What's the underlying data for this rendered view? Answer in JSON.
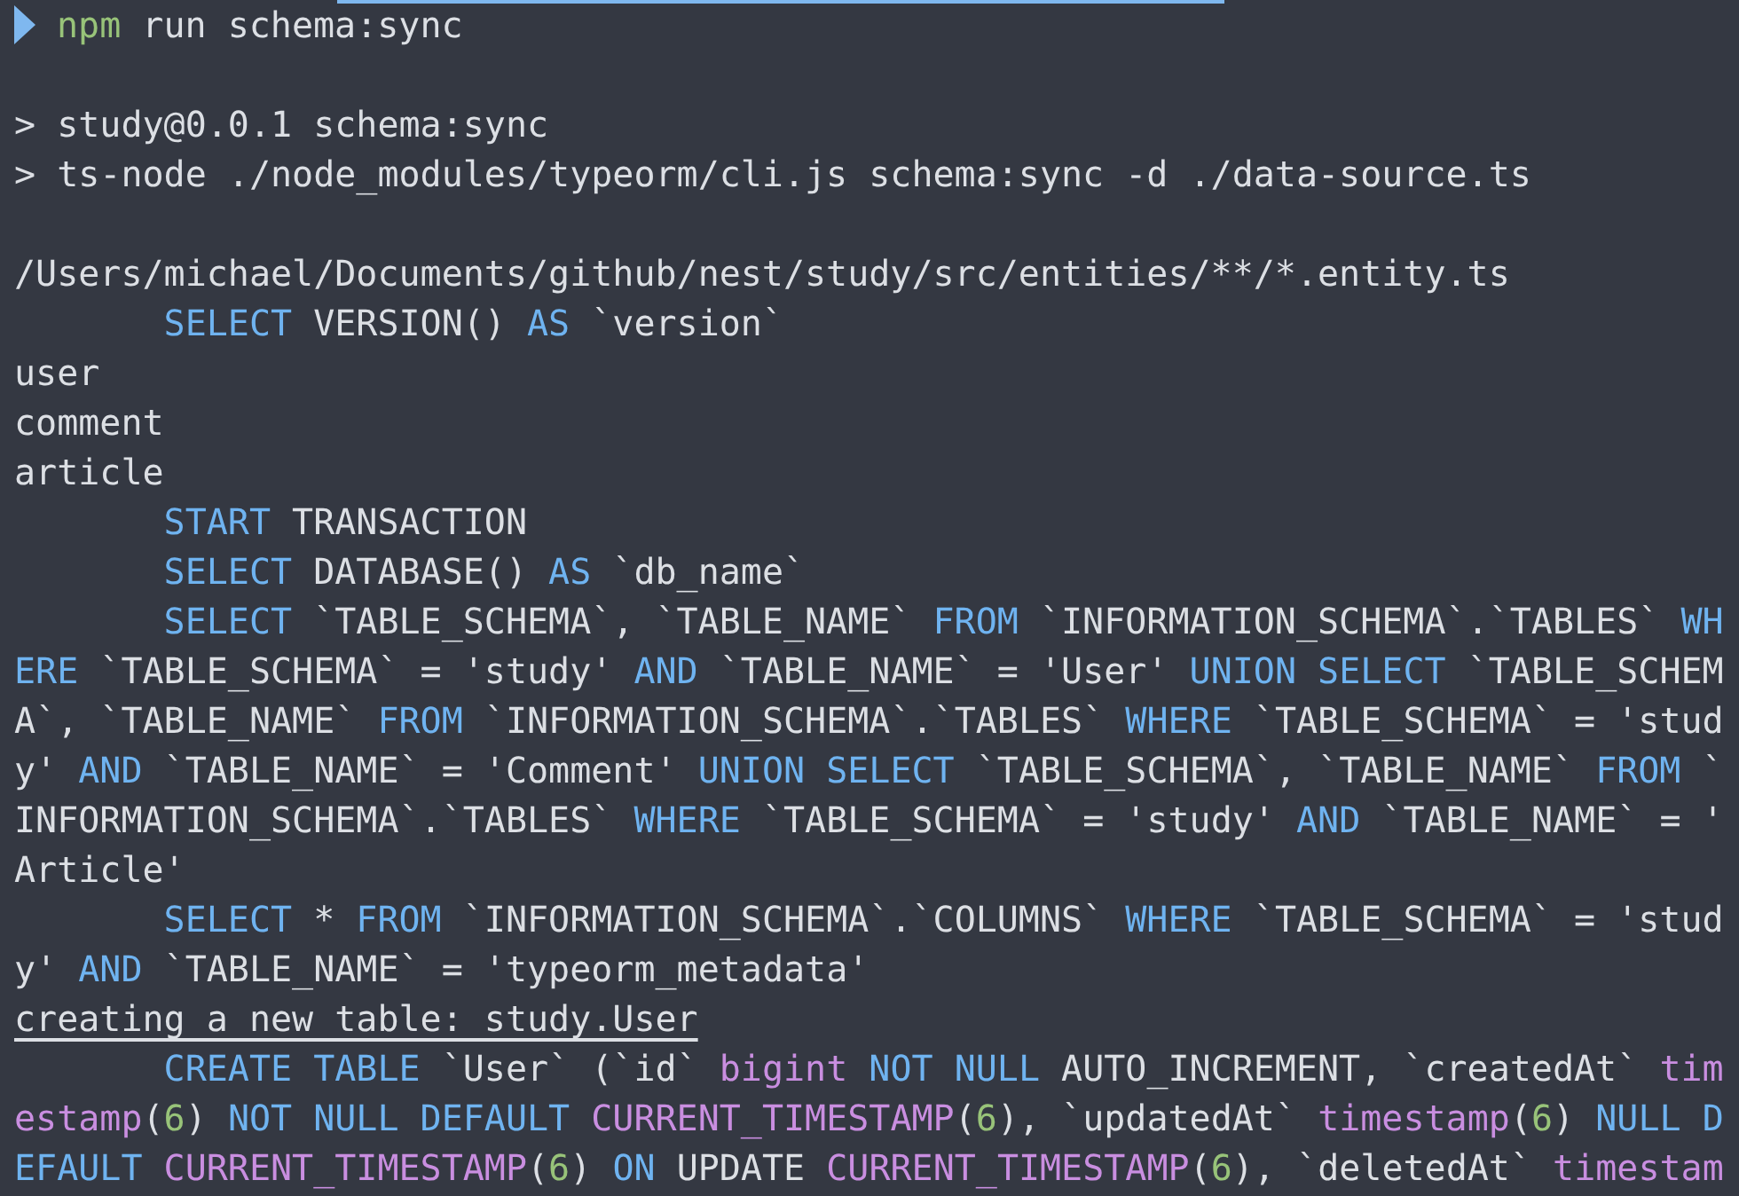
{
  "terminal": {
    "lines": [
      {
        "kind": "prompt",
        "indent": false,
        "segments": [
          {
            "kind": "cmd",
            "text": "npm"
          },
          {
            "kind": "plain",
            "text": " run schema:sync"
          }
        ]
      },
      {
        "kind": "blank"
      },
      {
        "kind": "output",
        "indent": false,
        "segments": [
          {
            "kind": "plain",
            "text": "> study@0.0.1 schema:sync"
          }
        ]
      },
      {
        "kind": "output",
        "indent": false,
        "segments": [
          {
            "kind": "plain",
            "text": "> ts-node ./node_modules/typeorm/cli.js schema:sync -d ./data-source.ts"
          }
        ]
      },
      {
        "kind": "blank"
      },
      {
        "kind": "output",
        "indent": false,
        "segments": [
          {
            "kind": "plain",
            "text": "/Users/michael/Documents/github/nest/study/src/entities/**/*.entity.ts"
          }
        ]
      },
      {
        "kind": "output",
        "indent": true,
        "segments": [
          {
            "kind": "keyword",
            "text": "SELECT"
          },
          {
            "kind": "plain",
            "text": " VERSION() "
          },
          {
            "kind": "keyword",
            "text": "AS"
          },
          {
            "kind": "plain",
            "text": " `version`"
          }
        ]
      },
      {
        "kind": "output",
        "indent": false,
        "segments": [
          {
            "kind": "plain",
            "text": "user"
          }
        ]
      },
      {
        "kind": "output",
        "indent": false,
        "segments": [
          {
            "kind": "plain",
            "text": "comment"
          }
        ]
      },
      {
        "kind": "output",
        "indent": false,
        "segments": [
          {
            "kind": "plain",
            "text": "article"
          }
        ]
      },
      {
        "kind": "output",
        "indent": true,
        "segments": [
          {
            "kind": "keyword",
            "text": "START"
          },
          {
            "kind": "plain",
            "text": " TRANSACTION"
          }
        ]
      },
      {
        "kind": "output",
        "indent": true,
        "segments": [
          {
            "kind": "keyword",
            "text": "SELECT"
          },
          {
            "kind": "plain",
            "text": " DATABASE() "
          },
          {
            "kind": "keyword",
            "text": "AS"
          },
          {
            "kind": "plain",
            "text": " `db_name`"
          }
        ]
      },
      {
        "kind": "output",
        "indent": true,
        "segments": [
          {
            "kind": "keyword",
            "text": "SELECT"
          },
          {
            "kind": "plain",
            "text": " `TABLE_SCHEMA`, `TABLE_NAME` "
          },
          {
            "kind": "keyword",
            "text": "FROM"
          },
          {
            "kind": "plain",
            "text": " `INFORMATION_SCHEMA`.`TABLES` "
          },
          {
            "kind": "keyword",
            "text": "WH"
          }
        ]
      },
      {
        "kind": "output",
        "indent": false,
        "segments": [
          {
            "kind": "keyword",
            "text": "ERE"
          },
          {
            "kind": "plain",
            "text": " `TABLE_SCHEMA` = 'study' "
          },
          {
            "kind": "keyword",
            "text": "AND"
          },
          {
            "kind": "plain",
            "text": " `TABLE_NAME` = 'User' "
          },
          {
            "kind": "keyword",
            "text": "UNION SELECT"
          },
          {
            "kind": "plain",
            "text": " `TABLE_SCHEM"
          }
        ]
      },
      {
        "kind": "output",
        "indent": false,
        "segments": [
          {
            "kind": "plain",
            "text": "A`, `TABLE_NAME` "
          },
          {
            "kind": "keyword",
            "text": "FROM"
          },
          {
            "kind": "plain",
            "text": " `INFORMATION_SCHEMA`.`TABLES` "
          },
          {
            "kind": "keyword",
            "text": "WHERE"
          },
          {
            "kind": "plain",
            "text": " `TABLE_SCHEMA` = 'stud"
          }
        ]
      },
      {
        "kind": "output",
        "indent": false,
        "segments": [
          {
            "kind": "plain",
            "text": "y' "
          },
          {
            "kind": "keyword",
            "text": "AND"
          },
          {
            "kind": "plain",
            "text": " `TABLE_NAME` = 'Comment' "
          },
          {
            "kind": "keyword",
            "text": "UNION SELECT"
          },
          {
            "kind": "plain",
            "text": " `TABLE_SCHEMA`, `TABLE_NAME` "
          },
          {
            "kind": "keyword",
            "text": "FROM"
          },
          {
            "kind": "plain",
            "text": " `"
          }
        ]
      },
      {
        "kind": "output",
        "indent": false,
        "segments": [
          {
            "kind": "plain",
            "text": "INFORMATION_SCHEMA`.`TABLES` "
          },
          {
            "kind": "keyword",
            "text": "WHERE"
          },
          {
            "kind": "plain",
            "text": " `TABLE_SCHEMA` = 'study' "
          },
          {
            "kind": "keyword",
            "text": "AND"
          },
          {
            "kind": "plain",
            "text": " `TABLE_NAME` = '"
          }
        ]
      },
      {
        "kind": "output",
        "indent": false,
        "segments": [
          {
            "kind": "plain",
            "text": "Article'"
          }
        ]
      },
      {
        "kind": "output",
        "indent": true,
        "segments": [
          {
            "kind": "keyword",
            "text": "SELECT"
          },
          {
            "kind": "plain",
            "text": " * "
          },
          {
            "kind": "keyword",
            "text": "FROM"
          },
          {
            "kind": "plain",
            "text": " `INFORMATION_SCHEMA`.`COLUMNS` "
          },
          {
            "kind": "keyword",
            "text": "WHERE"
          },
          {
            "kind": "plain",
            "text": " `TABLE_SCHEMA` = 'stud"
          }
        ]
      },
      {
        "kind": "output",
        "indent": false,
        "segments": [
          {
            "kind": "plain",
            "text": "y' "
          },
          {
            "kind": "keyword",
            "text": "AND"
          },
          {
            "kind": "plain",
            "text": " `TABLE_NAME` = 'typeorm_metadata'"
          }
        ]
      },
      {
        "kind": "underline",
        "indent": false,
        "segments": [
          {
            "kind": "plain",
            "text": "creating a new table: study.User"
          }
        ]
      },
      {
        "kind": "output",
        "indent": true,
        "segments": [
          {
            "kind": "keyword",
            "text": "CREATE TABLE"
          },
          {
            "kind": "plain",
            "text": " `User` (`id` "
          },
          {
            "kind": "type",
            "text": "bigint"
          },
          {
            "kind": "keyword",
            "text": " NOT NULL"
          },
          {
            "kind": "plain",
            "text": " AUTO_INCREMENT, `createdAt` "
          },
          {
            "kind": "type",
            "text": "tim"
          }
        ]
      },
      {
        "kind": "output",
        "indent": false,
        "segments": [
          {
            "kind": "type",
            "text": "estamp"
          },
          {
            "kind": "plain",
            "text": "("
          },
          {
            "kind": "number",
            "text": "6"
          },
          {
            "kind": "plain",
            "text": ") "
          },
          {
            "kind": "keyword",
            "text": "NOT NULL DEFAULT "
          },
          {
            "kind": "type",
            "text": "CURRENT_TIMESTAMP"
          },
          {
            "kind": "plain",
            "text": "("
          },
          {
            "kind": "number",
            "text": "6"
          },
          {
            "kind": "plain",
            "text": "), `updatedAt` "
          },
          {
            "kind": "type",
            "text": "timestamp"
          },
          {
            "kind": "plain",
            "text": "("
          },
          {
            "kind": "number",
            "text": "6"
          },
          {
            "kind": "plain",
            "text": ") "
          },
          {
            "kind": "keyword",
            "text": "NULL D"
          }
        ]
      },
      {
        "kind": "output",
        "indent": false,
        "segments": [
          {
            "kind": "keyword",
            "text": "EFAULT "
          },
          {
            "kind": "type",
            "text": "CURRENT_TIMESTAMP"
          },
          {
            "kind": "plain",
            "text": "("
          },
          {
            "kind": "number",
            "text": "6"
          },
          {
            "kind": "plain",
            "text": ") "
          },
          {
            "kind": "keyword",
            "text": "ON"
          },
          {
            "kind": "plain",
            "text": " UPDATE "
          },
          {
            "kind": "type",
            "text": "CURRENT_TIMESTAMP"
          },
          {
            "kind": "plain",
            "text": "("
          },
          {
            "kind": "number",
            "text": "6"
          },
          {
            "kind": "plain",
            "text": "), `deletedAt` "
          },
          {
            "kind": "type",
            "text": "timestam"
          }
        ]
      }
    ]
  }
}
